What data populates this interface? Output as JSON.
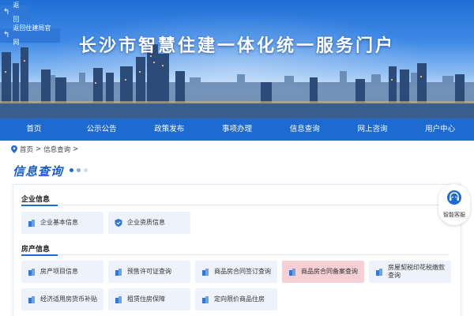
{
  "header": {
    "back_label": "返回",
    "back_site_label": "返回住建局官网",
    "site_title": "长沙市智慧住建一体化统一服务门户"
  },
  "nav": {
    "items": [
      "首页",
      "公示公告",
      "政策发布",
      "事项办理",
      "信息查询",
      "网上咨询",
      "用户中心"
    ]
  },
  "breadcrumb": {
    "home": "首页",
    "sep1": ">",
    "current": "信息查询",
    "sep2": ">"
  },
  "section": {
    "title": "信息查询"
  },
  "groups": {
    "enterprise": {
      "title": "企业信息",
      "items": [
        "企业基本信息",
        "企业资质信息"
      ]
    },
    "property": {
      "title": "房产信息",
      "items": [
        "房产项目信息",
        "预售许可证查询",
        "商品房合同签订查询",
        "商品房合同备案查询",
        "房屋契税印花税缴款",
        "查询",
        "经济适用房货币补贴",
        "租赁住房保障",
        "定向限价商品住房"
      ]
    }
  },
  "service": {
    "label": "智能客服"
  },
  "icons": {
    "back": "back-arrow-icon",
    "pin": "location-pin-icon",
    "building": "building-icon",
    "shield": "shield-icon",
    "headset": "headset-icon"
  },
  "colors": {
    "primary": "#1d6ad1",
    "card_bg": "#eef3fb",
    "card_active": "#f6d0d4",
    "title_blue": "#1a5fc7"
  }
}
